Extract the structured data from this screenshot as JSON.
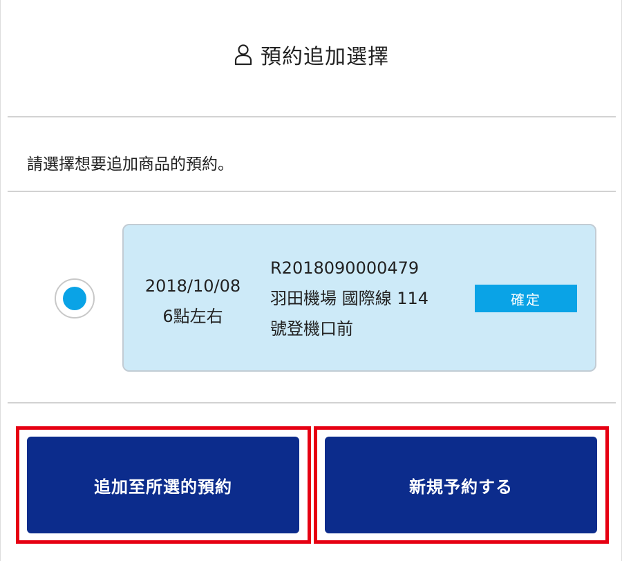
{
  "header": {
    "title": "預約追加選擇",
    "icon": "person-icon"
  },
  "instruction": "請選擇想要追加商品的預約。",
  "reservation": {
    "selected": true,
    "date": "2018/10/08",
    "time": "6點左右",
    "reservation_no": "R2018090000479",
    "location_line1": "羽田機場 國際線 114",
    "location_line2": "號登機口前",
    "status": "確定"
  },
  "actions": {
    "add_to_selected": "追加至所選的預約",
    "new_reservation": "新規予約する"
  },
  "colors": {
    "accent": "#0aa3e6",
    "card_background": "#cdeaf8",
    "button": "#0c2c8c",
    "highlight": "#e60012"
  }
}
